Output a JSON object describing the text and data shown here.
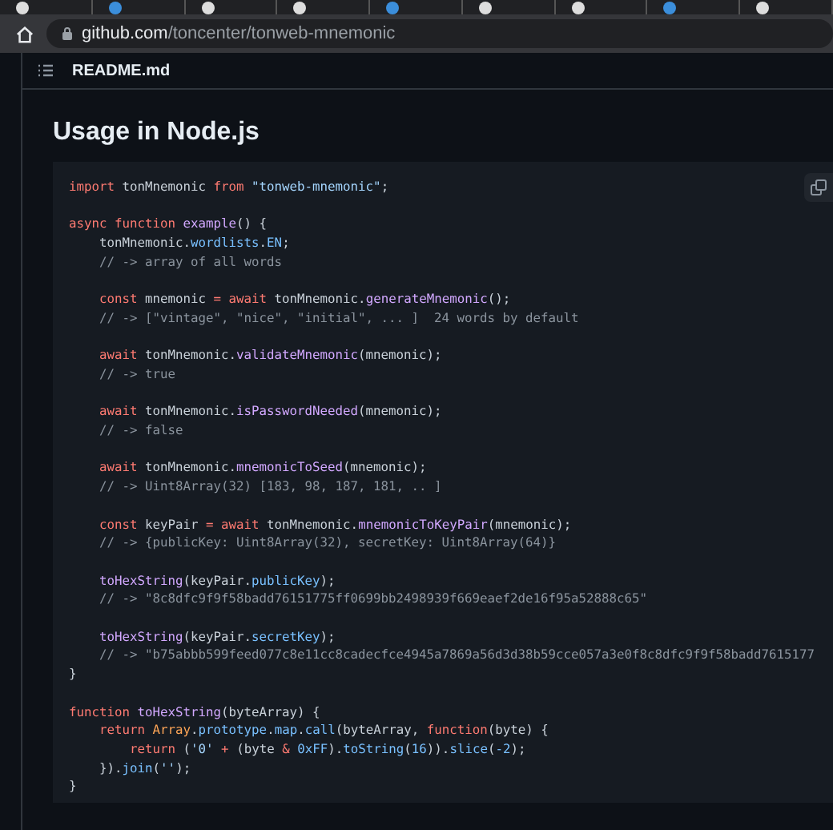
{
  "browser": {
    "url": {
      "host": "github.com",
      "path": "/toncenter/tonweb-mnemonic"
    }
  },
  "file_header": {
    "title": "README.md"
  },
  "heading": "Usage in Node.js",
  "code": {
    "blocks": [
      {
        "lines": [
          [
            {
              "kind": "kw",
              "text": "import"
            },
            {
              "kind": "pl",
              "text": " tonMnemonic "
            },
            {
              "kind": "kw",
              "text": "from "
            },
            {
              "kind": "str",
              "text": "\"tonweb-mnemonic\""
            },
            {
              "kind": "pl",
              "text": ";"
            }
          ]
        ]
      },
      {
        "lines": [
          [
            {
              "kind": "kw",
              "text": "async function "
            },
            {
              "kind": "fn",
              "text": "example"
            },
            {
              "kind": "pl",
              "text": "() {"
            }
          ],
          [
            {
              "kind": "pl",
              "text": "    tonMnemonic."
            },
            {
              "kind": "const",
              "text": "wordlists"
            },
            {
              "kind": "pl",
              "text": "."
            },
            {
              "kind": "const",
              "text": "EN"
            },
            {
              "kind": "pl",
              "text": ";"
            }
          ],
          [
            {
              "kind": "cm",
              "text": "    // -> array of all words"
            }
          ]
        ]
      },
      {
        "lines": [
          [
            {
              "kind": "kw",
              "text": "    const"
            },
            {
              "kind": "pl",
              "text": " mnemonic "
            },
            {
              "kind": "kw",
              "text": "= await"
            },
            {
              "kind": "pl",
              "text": " tonMnemonic."
            },
            {
              "kind": "fn",
              "text": "generateMnemonic"
            },
            {
              "kind": "pl",
              "text": "();"
            }
          ],
          [
            {
              "kind": "cm",
              "text": "    // -> [\"vintage\", \"nice\", \"initial\", ... ]  24 words by default"
            }
          ]
        ]
      },
      {
        "lines": [
          [
            {
              "kind": "kw",
              "text": "    await"
            },
            {
              "kind": "pl",
              "text": " tonMnemonic."
            },
            {
              "kind": "fn",
              "text": "validateMnemonic"
            },
            {
              "kind": "pl",
              "text": "(mnemonic);"
            }
          ],
          [
            {
              "kind": "cm",
              "text": "    // -> true"
            }
          ]
        ]
      },
      {
        "lines": [
          [
            {
              "kind": "kw",
              "text": "    await"
            },
            {
              "kind": "pl",
              "text": " tonMnemonic."
            },
            {
              "kind": "fn",
              "text": "isPasswordNeeded"
            },
            {
              "kind": "pl",
              "text": "(mnemonic);"
            }
          ],
          [
            {
              "kind": "cm",
              "text": "    // -> false"
            }
          ]
        ]
      },
      {
        "lines": [
          [
            {
              "kind": "kw",
              "text": "    await"
            },
            {
              "kind": "pl",
              "text": " tonMnemonic."
            },
            {
              "kind": "fn",
              "text": "mnemonicToSeed"
            },
            {
              "kind": "pl",
              "text": "(mnemonic);"
            }
          ],
          [
            {
              "kind": "cm",
              "text": "    // -> Uint8Array(32) [183, 98, 187, 181, .. ]"
            }
          ]
        ]
      },
      {
        "lines": [
          [
            {
              "kind": "kw",
              "text": "    const"
            },
            {
              "kind": "pl",
              "text": " keyPair "
            },
            {
              "kind": "kw",
              "text": "= await"
            },
            {
              "kind": "pl",
              "text": " tonMnemonic."
            },
            {
              "kind": "fn",
              "text": "mnemonicToKeyPair"
            },
            {
              "kind": "pl",
              "text": "(mnemonic);"
            }
          ],
          [
            {
              "kind": "cm",
              "text": "    // -> {publicKey: Uint8Array(32), secretKey: Uint8Array(64)}"
            }
          ]
        ]
      },
      {
        "lines": [
          [
            {
              "kind": "fn",
              "text": "    toHexString"
            },
            {
              "kind": "pl",
              "text": "(keyPair."
            },
            {
              "kind": "const",
              "text": "publicKey"
            },
            {
              "kind": "pl",
              "text": ");"
            }
          ],
          [
            {
              "kind": "cm",
              "text": "    // -> \"8c8dfc9f9f58badd76151775ff0699bb2498939f669eaef2de16f95a52888c65\""
            }
          ]
        ]
      },
      {
        "lines": [
          [
            {
              "kind": "fn",
              "text": "    toHexString"
            },
            {
              "kind": "pl",
              "text": "(keyPair."
            },
            {
              "kind": "const",
              "text": "secretKey"
            },
            {
              "kind": "pl",
              "text": ");"
            }
          ],
          [
            {
              "kind": "cm",
              "text": "    // -> \"b75abbb599feed077c8e11cc8cadecfce4945a7869a56d3d38b59cce057a3e0f8c8dfc9f9f58badd7615177"
            }
          ],
          [
            {
              "kind": "pl",
              "text": "}"
            }
          ]
        ]
      },
      {
        "lines": [
          [
            {
              "kind": "kw",
              "text": "function "
            },
            {
              "kind": "fn",
              "text": "toHexString"
            },
            {
              "kind": "pl",
              "text": "(byteArray) {"
            }
          ],
          [
            {
              "kind": "kw",
              "text": "    return "
            },
            {
              "kind": "cls",
              "text": "Array"
            },
            {
              "kind": "pl",
              "text": "."
            },
            {
              "kind": "const",
              "text": "prototype"
            },
            {
              "kind": "pl",
              "text": "."
            },
            {
              "kind": "const",
              "text": "map"
            },
            {
              "kind": "pl",
              "text": "."
            },
            {
              "kind": "const",
              "text": "call"
            },
            {
              "kind": "pl",
              "text": "(byteArray, "
            },
            {
              "kind": "kw",
              "text": "function"
            },
            {
              "kind": "pl",
              "text": "(byte) {"
            }
          ],
          [
            {
              "kind": "kw",
              "text": "        return"
            },
            {
              "kind": "pl",
              "text": " ("
            },
            {
              "kind": "str",
              "text": "'0'"
            },
            {
              "kind": "kw",
              "text": " + "
            },
            {
              "kind": "pl",
              "text": "(byte "
            },
            {
              "kind": "kw",
              "text": "& "
            },
            {
              "kind": "const",
              "text": "0xFF"
            },
            {
              "kind": "pl",
              "text": ")."
            },
            {
              "kind": "const",
              "text": "toString"
            },
            {
              "kind": "pl",
              "text": "("
            },
            {
              "kind": "const",
              "text": "16"
            },
            {
              "kind": "pl",
              "text": "))."
            },
            {
              "kind": "const",
              "text": "slice"
            },
            {
              "kind": "pl",
              "text": "("
            },
            {
              "kind": "const",
              "text": "-2"
            },
            {
              "kind": "pl",
              "text": ");"
            }
          ],
          [
            {
              "kind": "pl",
              "text": "    })."
            },
            {
              "kind": "const",
              "text": "join"
            },
            {
              "kind": "pl",
              "text": "("
            },
            {
              "kind": "str",
              "text": "''"
            },
            {
              "kind": "pl",
              "text": ");"
            }
          ],
          [
            {
              "kind": "pl",
              "text": "}"
            }
          ]
        ]
      }
    ]
  }
}
